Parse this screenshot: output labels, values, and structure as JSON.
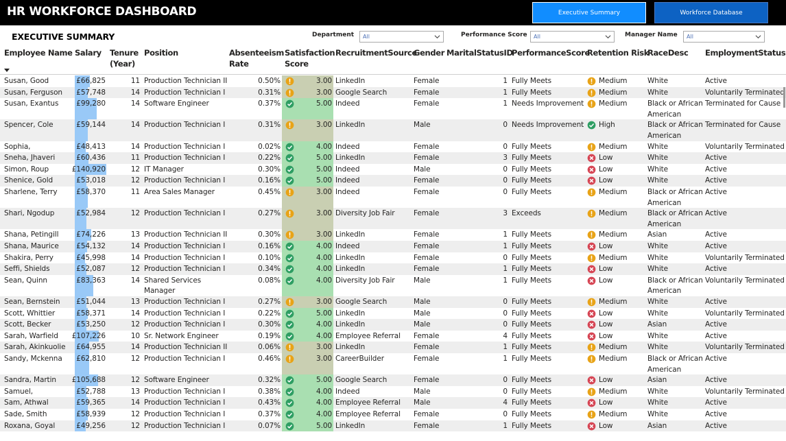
{
  "app": {
    "title": "HR WORKFORCE DASHBOARD",
    "nav": [
      "Executive Summary",
      "Workforce Database"
    ]
  },
  "section_title": "EXECUTIVE SUMMARY",
  "filters": [
    {
      "label": "Department",
      "value": "All"
    },
    {
      "label": "Performance Score",
      "value": "All"
    },
    {
      "label": "Manager Name",
      "value": "All"
    }
  ],
  "columns": {
    "name": "Employee Name",
    "salary": "Salary",
    "tenure_a": "Tenure",
    "tenure_b": "(Year)",
    "position": "Position",
    "absent_a": "Absenteeism",
    "absent_b": "Rate",
    "sat_a": "Satisfaction",
    "sat_b": "Score",
    "source": "RecruitmentSource",
    "gender": "Gender",
    "marital": "MaritalStatusID",
    "perf": "PerformanceScore",
    "retention": "Retention Risk",
    "race": "RaceDesc",
    "status": "EmploymentStatus"
  },
  "colors": {
    "sat_high": "#a9dfb1",
    "sat_mid": "#c9cfb2",
    "status_ok": "#2e9e63",
    "status_warn": "#e8a317",
    "status_bad": "#d64554",
    "salary_bar": "#99c9f7",
    "nav_active": "#118DFF",
    "nav_inactive": "#0D62C3"
  },
  "rows": [
    {
      "name": "Susan, Good",
      "salary": "£66,825",
      "salary_value": 66825,
      "tenure": "11",
      "position": "Production Technician II",
      "absent": "0.50%",
      "sat": "3.00",
      "sat_icon": "warning-icon",
      "source": "LinkedIn",
      "gender": "Female",
      "marital": "1",
      "perf": "Fully Meets",
      "risk_icon": "warning-icon",
      "risk": "Medium",
      "race": "White",
      "status": "Active"
    },
    {
      "name": "Susan, Ferguson",
      "salary": "£57,748",
      "salary_value": 57748,
      "tenure": "14",
      "position": "Production Technician I",
      "absent": "0.31%",
      "sat": "3.00",
      "sat_icon": "warning-icon",
      "source": "Google Search",
      "gender": "Female",
      "marital": "1",
      "perf": "Fully Meets",
      "risk_icon": "warning-icon",
      "risk": "Medium",
      "race": "White",
      "status": "Voluntarily Terminated"
    },
    {
      "name": "Susan, Exantus",
      "salary": "£99,280",
      "salary_value": 99280,
      "tenure": "14",
      "position": "Software Engineer",
      "absent": "0.37%",
      "sat": "5.00",
      "sat_icon": "check-icon",
      "source": "Indeed",
      "gender": "Female",
      "marital": "1",
      "perf": "Needs Improvement",
      "risk_icon": "warning-icon",
      "risk": "Medium",
      "race": "Black or African American",
      "status": "Terminated for Cause"
    },
    {
      "name": "Spencer, Cole",
      "salary": "£59,144",
      "salary_value": 59144,
      "tenure": "14",
      "position": "Production Technician I",
      "absent": "0.31%",
      "sat": "3.00",
      "sat_icon": "warning-icon",
      "source": "LinkedIn",
      "gender": "Male",
      "marital": "0",
      "perf": "Needs Improvement",
      "risk_icon": "check-icon",
      "risk": "High",
      "race": "Black or African American",
      "status": "Terminated for Cause"
    },
    {
      "name": "Sophia, Theamstern",
      "salary": "£48,413",
      "salary_value": 48413,
      "tenure": "14",
      "position": "Production Technician I",
      "absent": "0.02%",
      "sat": "4.00",
      "sat_icon": "check-icon",
      "source": "Indeed",
      "gender": "Female",
      "marital": "0",
      "perf": "Fully Meets",
      "risk_icon": "warning-icon",
      "risk": "Medium",
      "race": "White",
      "status": "Voluntarily Terminated"
    },
    {
      "name": "Sneha, Jhaveri",
      "salary": "£60,436",
      "salary_value": 60436,
      "tenure": "11",
      "position": "Production Technician I",
      "absent": "0.22%",
      "sat": "5.00",
      "sat_icon": "check-icon",
      "source": "LinkedIn",
      "gender": "Female",
      "marital": "3",
      "perf": "Fully Meets",
      "risk_icon": "x-icon",
      "risk": "Low",
      "race": "White",
      "status": "Active"
    },
    {
      "name": "Simon, Roup",
      "salary": "£140,920",
      "salary_value": 140920,
      "tenure": "12",
      "position": "IT Manager",
      "absent": "0.30%",
      "sat": "5.00",
      "sat_icon": "check-icon",
      "source": "Indeed",
      "gender": "Male",
      "marital": "0",
      "perf": "Fully Meets",
      "risk_icon": "x-icon",
      "risk": "Low",
      "race": "White",
      "status": "Active"
    },
    {
      "name": "Shenice, Gold",
      "salary": "£53,018",
      "salary_value": 53018,
      "tenure": "12",
      "position": "Production Technician I",
      "absent": "0.16%",
      "sat": "5.00",
      "sat_icon": "check-icon",
      "source": "Indeed",
      "gender": "Female",
      "marital": "0",
      "perf": "Fully Meets",
      "risk_icon": "x-icon",
      "risk": "Low",
      "race": "White",
      "status": "Active"
    },
    {
      "name": "Sharlene, Terry",
      "salary": "£58,370",
      "salary_value": 58370,
      "tenure": "11",
      "position": "Area Sales Manager",
      "absent": "0.45%",
      "sat": "3.00",
      "sat_icon": "warning-icon",
      "source": "Indeed",
      "gender": "Female",
      "marital": "0",
      "perf": "Fully Meets",
      "risk_icon": "warning-icon",
      "risk": "Medium",
      "race": "Black or African American",
      "status": "Active"
    },
    {
      "name": "Shari, Ngodup",
      "salary": "£52,984",
      "salary_value": 52984,
      "tenure": "12",
      "position": "Production Technician I",
      "absent": "0.27%",
      "sat": "3.00",
      "sat_icon": "warning-icon",
      "source": "Diversity Job Fair",
      "gender": "Female",
      "marital": "3",
      "perf": "Exceeds",
      "risk_icon": "warning-icon",
      "risk": "Medium",
      "race": "Black or African American",
      "status": "Active"
    },
    {
      "name": "Shana, Petingill",
      "salary": "£74,226",
      "salary_value": 74226,
      "tenure": "13",
      "position": "Production Technician II",
      "absent": "0.30%",
      "sat": "3.00",
      "sat_icon": "warning-icon",
      "source": "LinkedIn",
      "gender": "Female",
      "marital": "1",
      "perf": "Fully Meets",
      "risk_icon": "warning-icon",
      "risk": "Medium",
      "race": "Asian",
      "status": "Active"
    },
    {
      "name": "Shana, Maurice",
      "salary": "£54,132",
      "salary_value": 54132,
      "tenure": "14",
      "position": "Production Technician I",
      "absent": "0.16%",
      "sat": "4.00",
      "sat_icon": "check-icon",
      "source": "Indeed",
      "gender": "Female",
      "marital": "1",
      "perf": "Fully Meets",
      "risk_icon": "x-icon",
      "risk": "Low",
      "race": "White",
      "status": "Active"
    },
    {
      "name": "Shakira, Perry",
      "salary": "£45,998",
      "salary_value": 45998,
      "tenure": "14",
      "position": "Production Technician I",
      "absent": "0.10%",
      "sat": "4.00",
      "sat_icon": "check-icon",
      "source": "LinkedIn",
      "gender": "Female",
      "marital": "0",
      "perf": "Fully Meets",
      "risk_icon": "warning-icon",
      "risk": "Medium",
      "race": "White",
      "status": "Voluntarily Terminated"
    },
    {
      "name": "Seffi, Shields",
      "salary": "£52,087",
      "salary_value": 52087,
      "tenure": "12",
      "position": "Production Technician I",
      "absent": "0.34%",
      "sat": "4.00",
      "sat_icon": "check-icon",
      "source": "LinkedIn",
      "gender": "Female",
      "marital": "1",
      "perf": "Fully Meets",
      "risk_icon": "x-icon",
      "risk": "Low",
      "race": "White",
      "status": "Active"
    },
    {
      "name": "Sean, Quinn",
      "salary": "£83,363",
      "salary_value": 83363,
      "tenure": "14",
      "position": "Shared Services Manager",
      "absent": "0.08%",
      "sat": "4.00",
      "sat_icon": "check-icon",
      "source": "Diversity Job Fair",
      "gender": "Male",
      "marital": "1",
      "perf": "Fully Meets",
      "risk_icon": "x-icon",
      "risk": "Low",
      "race": "Black or African American",
      "status": "Voluntarily Terminated"
    },
    {
      "name": "Sean, Bernstein",
      "salary": "£51,044",
      "salary_value": 51044,
      "tenure": "13",
      "position": "Production Technician I",
      "absent": "0.27%",
      "sat": "3.00",
      "sat_icon": "warning-icon",
      "source": "Google Search",
      "gender": "Male",
      "marital": "0",
      "perf": "Fully Meets",
      "risk_icon": "warning-icon",
      "risk": "Medium",
      "race": "White",
      "status": "Active"
    },
    {
      "name": "Scott, Whittier",
      "salary": "£58,371",
      "salary_value": 58371,
      "tenure": "14",
      "position": "Production Technician I",
      "absent": "0.22%",
      "sat": "5.00",
      "sat_icon": "check-icon",
      "source": "LinkedIn",
      "gender": "Male",
      "marital": "0",
      "perf": "Fully Meets",
      "risk_icon": "x-icon",
      "risk": "Low",
      "race": "White",
      "status": "Voluntarily Terminated"
    },
    {
      "name": "Scott, Becker",
      "salary": "£53,250",
      "salary_value": 53250,
      "tenure": "12",
      "position": "Production Technician I",
      "absent": "0.30%",
      "sat": "4.00",
      "sat_icon": "check-icon",
      "source": "LinkedIn",
      "gender": "Male",
      "marital": "0",
      "perf": "Fully Meets",
      "risk_icon": "x-icon",
      "risk": "Low",
      "race": "Asian",
      "status": "Active"
    },
    {
      "name": "Sarah, Warfield",
      "salary": "£107,226",
      "salary_value": 107226,
      "tenure": "10",
      "position": "Sr. Network Engineer",
      "absent": "0.19%",
      "sat": "4.00",
      "sat_icon": "check-icon",
      "source": "Employee Referral",
      "gender": "Female",
      "marital": "4",
      "perf": "Fully Meets",
      "risk_icon": "x-icon",
      "risk": "Low",
      "race": "White",
      "status": "Active"
    },
    {
      "name": "Sarah, Akinkuolie",
      "salary": "£64,955",
      "salary_value": 64955,
      "tenure": "14",
      "position": "Production Technician II",
      "absent": "0.06%",
      "sat": "3.00",
      "sat_icon": "warning-icon",
      "source": "LinkedIn",
      "gender": "Female",
      "marital": "1",
      "perf": "Fully Meets",
      "risk_icon": "warning-icon",
      "risk": "Medium",
      "race": "White",
      "status": "Voluntarily Terminated"
    },
    {
      "name": "Sandy, Mckenna",
      "salary": "£62,810",
      "salary_value": 62810,
      "tenure": "12",
      "position": "Production Technician I",
      "absent": "0.46%",
      "sat": "3.00",
      "sat_icon": "warning-icon",
      "source": "CareerBuilder",
      "gender": "Female",
      "marital": "1",
      "perf": "Fully Meets",
      "risk_icon": "warning-icon",
      "risk": "Medium",
      "race": "Black or African American",
      "status": "Active"
    },
    {
      "name": "Sandra, Martin",
      "salary": "£105,688",
      "salary_value": 105688,
      "tenure": "12",
      "position": "Software Engineer",
      "absent": "0.32%",
      "sat": "5.00",
      "sat_icon": "check-icon",
      "source": "Google Search",
      "gender": "Female",
      "marital": "0",
      "perf": "Fully Meets",
      "risk_icon": "x-icon",
      "risk": "Low",
      "race": "Asian",
      "status": "Active"
    },
    {
      "name": "Samuel, Maclennan",
      "salary": "£52,788",
      "salary_value": 52788,
      "tenure": "13",
      "position": "Production Technician I",
      "absent": "0.38%",
      "sat": "4.00",
      "sat_icon": "check-icon",
      "source": "Indeed",
      "gender": "Male",
      "marital": "0",
      "perf": "Fully Meets",
      "risk_icon": "warning-icon",
      "risk": "Medium",
      "race": "White",
      "status": "Voluntarily Terminated"
    },
    {
      "name": "Sam, Athwal",
      "salary": "£59,365",
      "salary_value": 59365,
      "tenure": "14",
      "position": "Production Technician I",
      "absent": "0.43%",
      "sat": "4.00",
      "sat_icon": "check-icon",
      "source": "Employee Referral",
      "gender": "Male",
      "marital": "4",
      "perf": "Fully Meets",
      "risk_icon": "x-icon",
      "risk": "Low",
      "race": "White",
      "status": "Active"
    },
    {
      "name": "Sade, Smith",
      "salary": "£58,939",
      "salary_value": 58939,
      "tenure": "12",
      "position": "Production Technician I",
      "absent": "0.37%",
      "sat": "4.00",
      "sat_icon": "check-icon",
      "source": "Employee Referral",
      "gender": "Female",
      "marital": "0",
      "perf": "Fully Meets",
      "risk_icon": "warning-icon",
      "risk": "Medium",
      "race": "White",
      "status": "Active"
    },
    {
      "name": "Roxana, Goyal",
      "salary": "£49,256",
      "salary_value": 49256,
      "tenure": "12",
      "position": "Production Technician I",
      "absent": "0.07%",
      "sat": "5.00",
      "sat_icon": "check-icon",
      "source": "LinkedIn",
      "gender": "Female",
      "marital": "1",
      "perf": "Fully Meets",
      "risk_icon": "x-icon",
      "risk": "Low",
      "race": "Asian",
      "status": "Active"
    }
  ]
}
